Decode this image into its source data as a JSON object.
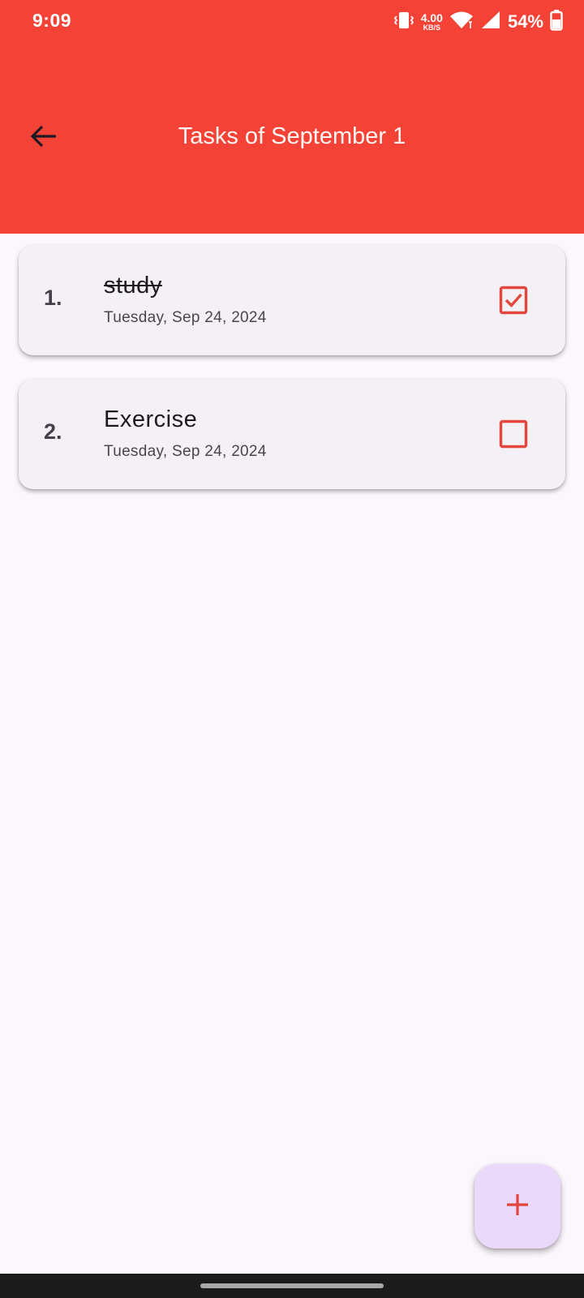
{
  "colors": {
    "accent": "#f44336",
    "background": "#fcf7fd",
    "card": "#f4f1f6",
    "fab": "#ead9fb"
  },
  "status_bar": {
    "time": "9:09",
    "net_speed_value": "4.00",
    "net_speed_unit": "KB/S",
    "battery": "54%",
    "icons": [
      "vibrate-icon",
      "wifi-icon",
      "signal-icon",
      "battery-icon"
    ]
  },
  "app_bar": {
    "back_icon": "arrow-left-icon",
    "title": "Tasks of September 1"
  },
  "tasks": [
    {
      "number": "1.",
      "title": "study",
      "date": "Tuesday, Sep 24, 2024",
      "completed": true
    },
    {
      "number": "2.",
      "title": "Exercise",
      "date": "Tuesday, Sep 24, 2024",
      "completed": false
    }
  ],
  "fab": {
    "icon": "plus-icon"
  }
}
